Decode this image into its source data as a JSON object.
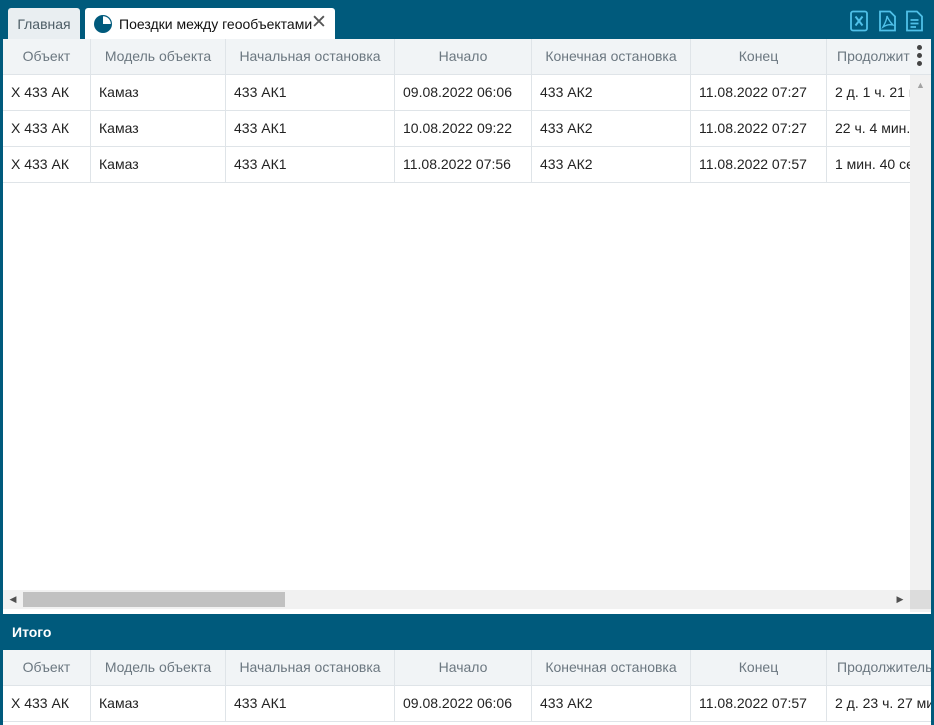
{
  "tabs": [
    {
      "label": "Главная",
      "active": false
    },
    {
      "label": "Поездки между геообъектами",
      "active": true
    }
  ],
  "tab_close_glyph": "✕",
  "export_buttons": [
    {
      "icon": "excel-export-icon"
    },
    {
      "icon": "pdf-export-icon"
    },
    {
      "icon": "document-export-icon"
    }
  ],
  "colors": {
    "brand": "#005a7c",
    "header_bg": "#f1f4f6",
    "grid_line": "#dfe4e8"
  },
  "trips_grid": {
    "columns": [
      "Объект",
      "Модель объекта",
      "Начальная остановка",
      "Начало",
      "Конечная остановка",
      "Конец",
      "Продолжит"
    ],
    "rows": [
      [
        "Х 433 АК",
        "Камаз",
        "433 АК1",
        "09.08.2022 06:06",
        "433 АК2",
        "11.08.2022 07:27",
        "2 д. 1 ч. 21 м"
      ],
      [
        "Х 433 АК",
        "Камаз",
        "433 АК1",
        "10.08.2022 09:22",
        "433 АК2",
        "11.08.2022 07:27",
        "22 ч. 4 мин."
      ],
      [
        "Х 433 АК",
        "Камаз",
        "433 АК1",
        "11.08.2022 07:56",
        "433 АК2",
        "11.08.2022 07:57",
        "1 мин. 40 се"
      ]
    ]
  },
  "total": {
    "label": "Итого",
    "columns": [
      "Объект",
      "Модель объекта",
      "Начальная остановка",
      "Начало",
      "Конечная остановка",
      "Конец",
      "Продолжитель"
    ],
    "row": [
      "Х 433 АК",
      "Камаз",
      "433 АК1",
      "09.08.2022 06:06",
      "433 АК2",
      "11.08.2022 07:57",
      "2 д. 23 ч. 27 ми"
    ]
  }
}
